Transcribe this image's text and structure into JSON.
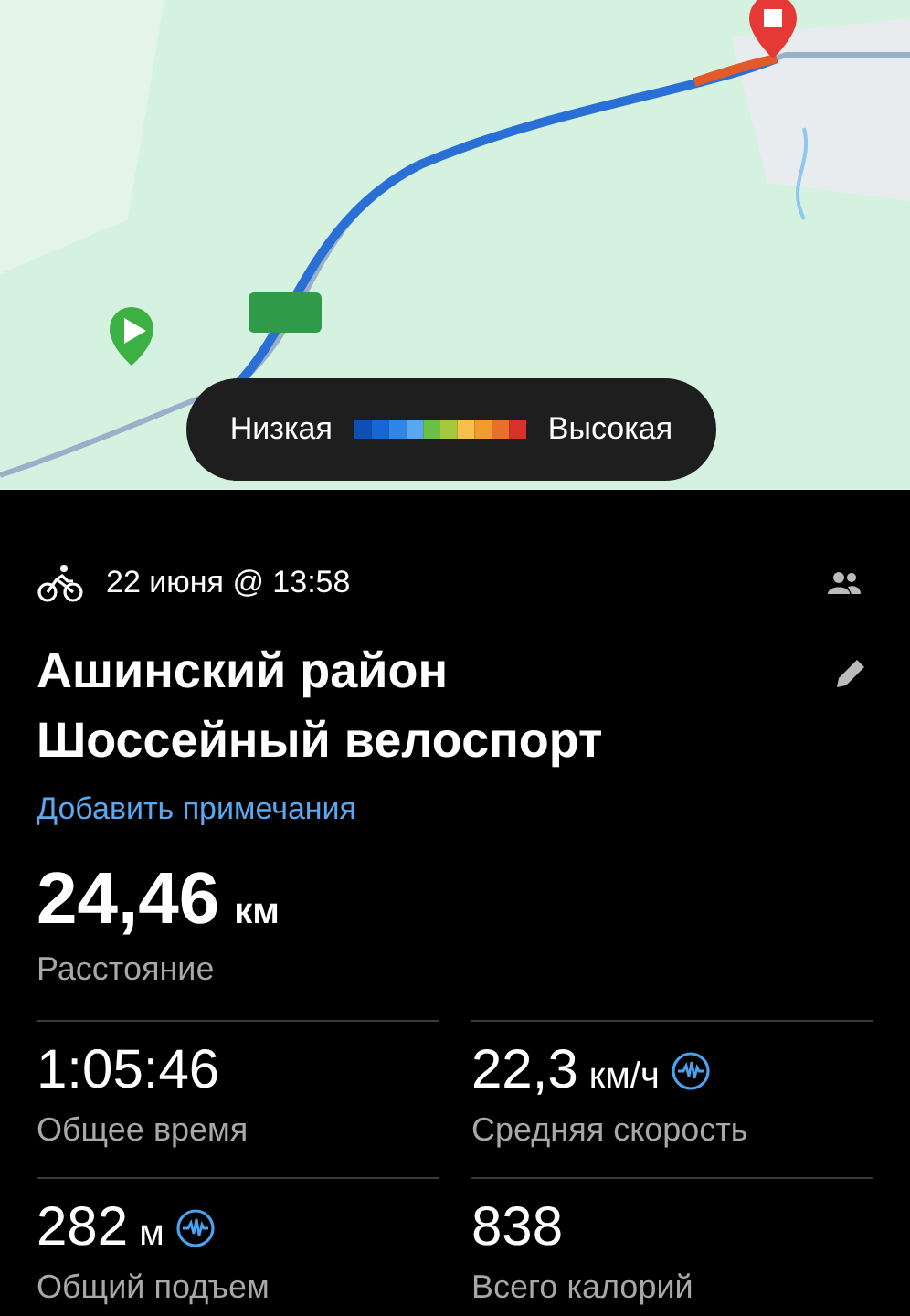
{
  "legend": {
    "low": "Низкая",
    "high": "Высокая"
  },
  "activity": {
    "date": "22 июня @ 13:58",
    "title_lines": [
      "Ашинский район",
      "Шоссейный велоспорт"
    ],
    "add_notes": "Добавить примечания"
  },
  "distance": {
    "value": "24,46",
    "unit": "км",
    "label": "Расстояние"
  },
  "stats": [
    {
      "value": "1:05:46",
      "label": "Общее время",
      "has_chart": false
    },
    {
      "value": "22,3",
      "unit": "км/ч",
      "label": "Средняя скорость",
      "has_chart": true
    },
    {
      "value": "282",
      "unit": "м",
      "label": "Общий подъем",
      "has_chart": true
    },
    {
      "value": "838",
      "label": "Всего калорий",
      "has_chart": false
    }
  ]
}
